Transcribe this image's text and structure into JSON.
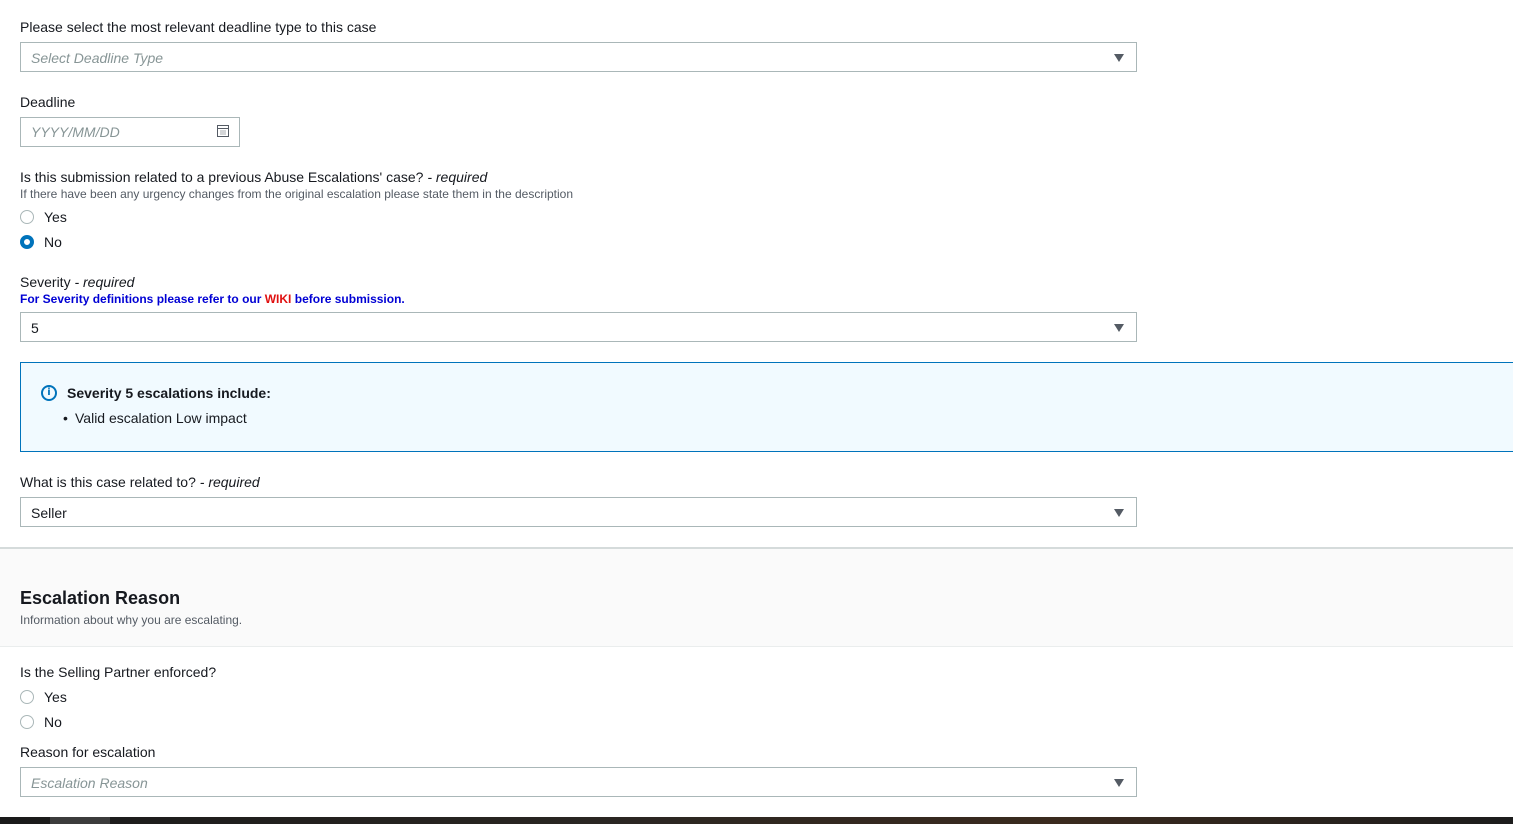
{
  "deadline_type": {
    "label": "Please select the most relevant deadline type to this case",
    "placeholder": "Select Deadline Type"
  },
  "deadline": {
    "label": "Deadline",
    "placeholder": "YYYY/MM/DD",
    "calendar_icon": "calendar-icon"
  },
  "previous_case": {
    "label": "Is this submission related to a previous Abuse Escalations' case?",
    "required_suffix": "- required",
    "hint": "If there have been any urgency changes from the original escalation please state them in the description",
    "options": [
      {
        "label": "Yes",
        "checked": false
      },
      {
        "label": "No",
        "checked": true
      }
    ]
  },
  "severity": {
    "label": "Severity",
    "required_suffix": "- required",
    "note_before": "For Severity definitions please refer to our ",
    "note_link": "WIKI",
    "note_after": " before submission.",
    "value": "5",
    "info_icon": "info-icon",
    "info_title": "Severity 5 escalations include:",
    "info_items": [
      "Valid escalation Low impact"
    ]
  },
  "related_to": {
    "label": "What is this case related to?",
    "required_suffix": "- required",
    "value": "Seller"
  },
  "escalation_section": {
    "title": "Escalation Reason",
    "description": "Information about why you are escalating."
  },
  "enforced": {
    "label": "Is the Selling Partner enforced?",
    "options": [
      {
        "label": "Yes",
        "checked": false
      },
      {
        "label": "No",
        "checked": false
      }
    ]
  },
  "reason": {
    "label": "Reason for escalation",
    "placeholder": "Escalation Reason"
  },
  "colors": {
    "accent": "#0073bb",
    "note_blue": "#0000d4",
    "wiki_red": "#e01010",
    "info_bg": "#f1faff"
  }
}
